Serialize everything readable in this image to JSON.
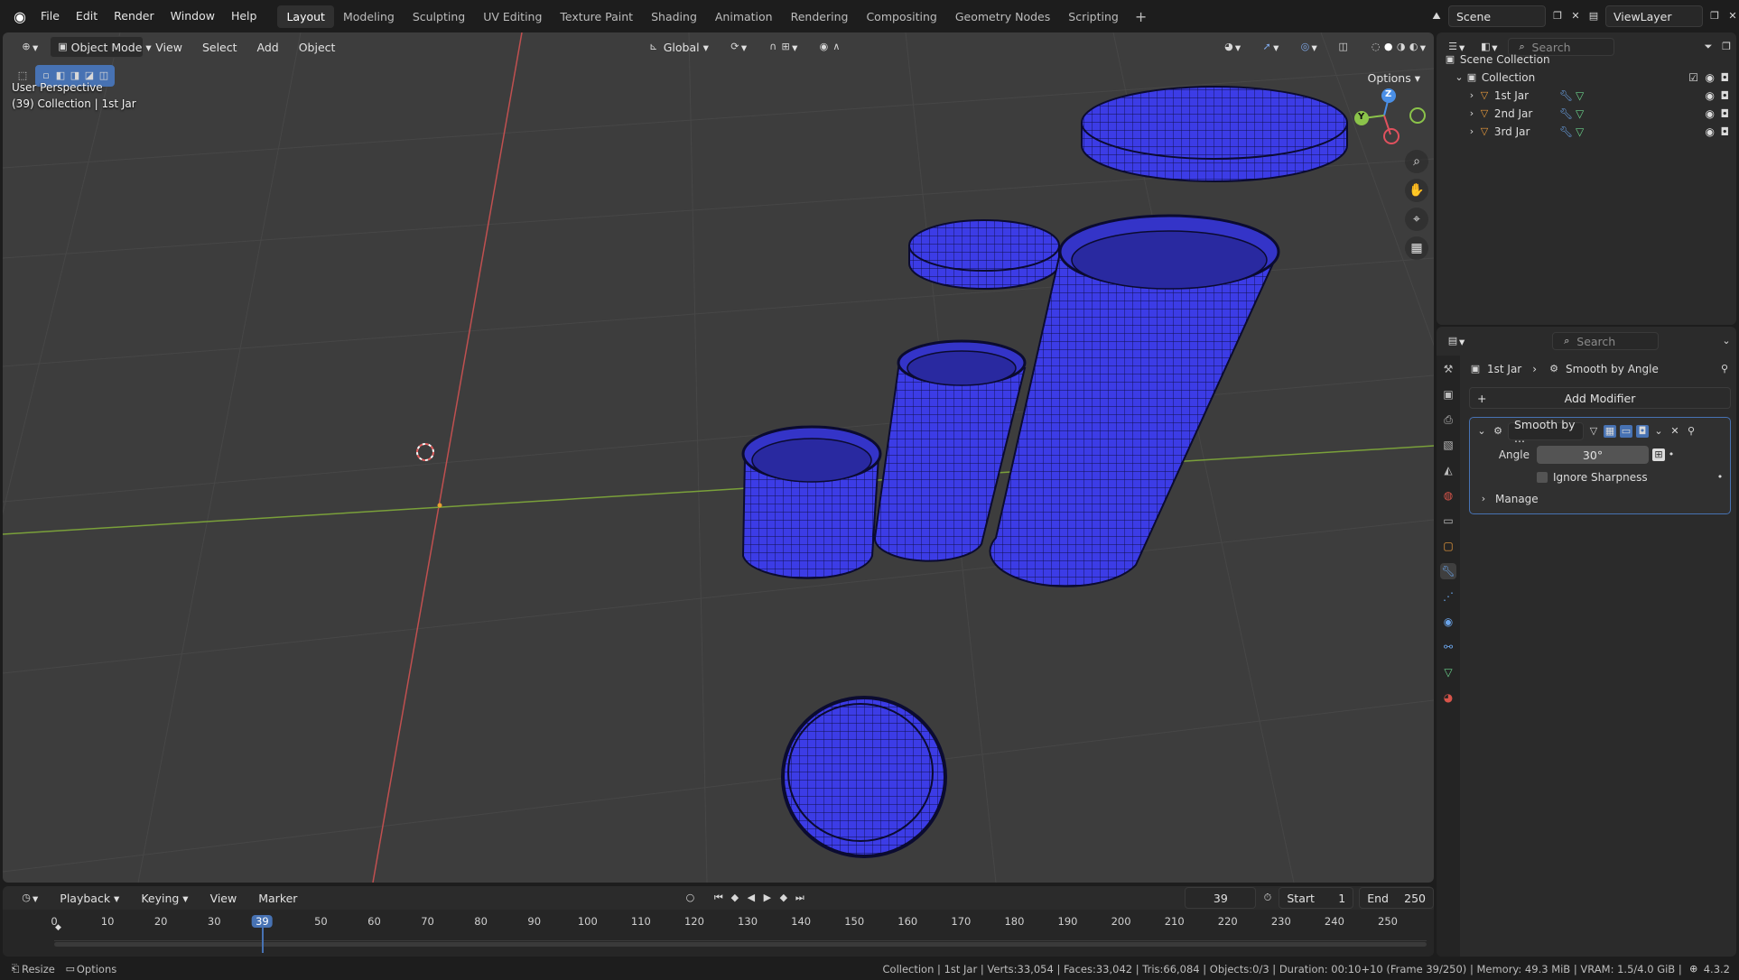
{
  "topbar": {
    "menus": [
      "File",
      "Edit",
      "Render",
      "Window",
      "Help"
    ],
    "workspaces": [
      "Layout",
      "Modeling",
      "Sculpting",
      "UV Editing",
      "Texture Paint",
      "Shading",
      "Animation",
      "Rendering",
      "Compositing",
      "Geometry Nodes",
      "Scripting"
    ],
    "active_workspace": "Layout",
    "scene": "Scene",
    "view_layer": "ViewLayer"
  },
  "viewport": {
    "mode": "Object Mode",
    "menus": [
      "View",
      "Select",
      "Add",
      "Object"
    ],
    "orientation": "Global",
    "options_label": "Options",
    "info_line1": "User Perspective",
    "info_line2": "(39) Collection | 1st Jar",
    "gizmo": {
      "x_color": "#e0515e",
      "y_color": "#8bc34a",
      "z_color": "#4a8fe6",
      "y_label": "Y",
      "z_label": "Z"
    }
  },
  "timeline": {
    "menus": [
      "Playback",
      "Keying",
      "View",
      "Marker"
    ],
    "current_frame": "39",
    "start_label": "Start",
    "start": "1",
    "end_label": "End",
    "end": "250",
    "ticks": [
      0,
      10,
      20,
      30,
      39,
      50,
      60,
      70,
      80,
      90,
      100,
      110,
      120,
      130,
      140,
      150,
      160,
      170,
      180,
      190,
      200,
      210,
      220,
      230,
      240,
      250
    ]
  },
  "outliner": {
    "search_placeholder": "Search",
    "scene_collection": "Scene Collection",
    "collection": "Collection",
    "objects": [
      "1st Jar",
      "2nd Jar",
      "3rd Jar"
    ]
  },
  "properties": {
    "search_placeholder": "Search",
    "breadcrumb_object": "1st Jar",
    "breadcrumb_modifier": "Smooth by Angle",
    "add_modifier": "Add Modifier",
    "modifier_name": "Smooth by ...",
    "angle_label": "Angle",
    "angle_value": "30°",
    "ignore_sharpness": "Ignore Sharpness",
    "manage": "Manage"
  },
  "status": {
    "left1": "Resize",
    "left2": "Options",
    "info": "Collection | 1st Jar | Verts:33,054 | Faces:33,042 | Tris:66,084 | Objects:0/3 | Duration: 00:10+10 (Frame 39/250) | Memory: 49.3 MiB | VRAM: 1.5/4.0 GiB |",
    "version": "4.3.2"
  },
  "colors": {
    "accent": "#4772b3",
    "mesh": "#3c3ce6",
    "grid": "#474747"
  }
}
